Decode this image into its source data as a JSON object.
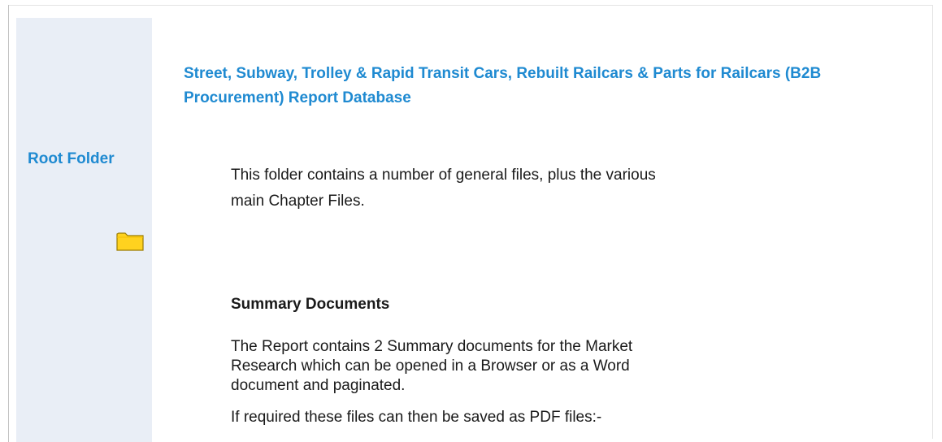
{
  "sidebar": {
    "title": "Root Folder",
    "icon": "folder-icon"
  },
  "content": {
    "title": "Street, Subway, Trolley & Rapid Transit Cars, Rebuilt Railcars & Parts for Railcars (B2B Procurement) Report Database",
    "intro": "This folder contains a number of general files, plus the various main Chapter Files.",
    "summary_heading": "Summary Documents",
    "summary_body": "The Report contains 2 Summary documents for the Market Research which can be opened in a Browser or as a Word document and paginated.",
    "pdf_note": "If required these files can then be saved as PDF files:-"
  },
  "colors": {
    "accent": "#1f8ad1",
    "sidebar_bg": "#e9eef6",
    "folder_fill": "#ffd21f",
    "folder_edge": "#9a7b00"
  }
}
